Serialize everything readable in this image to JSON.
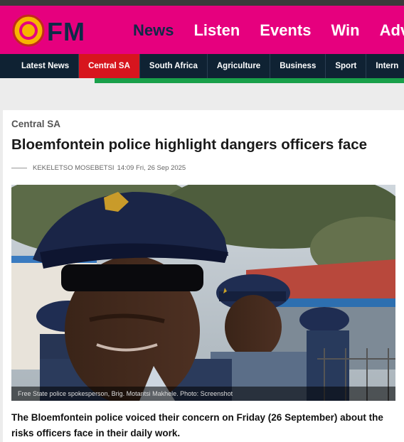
{
  "brand": {
    "logo_text": "OFM"
  },
  "main_nav": {
    "items": [
      {
        "label": "News",
        "active": true
      },
      {
        "label": "Listen",
        "active": false
      },
      {
        "label": "Events",
        "active": false
      },
      {
        "label": "Win",
        "active": false
      },
      {
        "label": "Adv",
        "active": false
      }
    ]
  },
  "sub_nav": {
    "items": [
      {
        "label": "Latest News",
        "active": false
      },
      {
        "label": "Central SA",
        "active": true
      },
      {
        "label": "South Africa",
        "active": false
      },
      {
        "label": "Agriculture",
        "active": false
      },
      {
        "label": "Business",
        "active": false
      },
      {
        "label": "Sport",
        "active": false
      },
      {
        "label": "Intern",
        "active": false
      }
    ]
  },
  "article": {
    "category": "Central SA",
    "title": "Bloemfontein police highlight dangers officers face",
    "author": "KEKELETSO MOSEBETSI",
    "date": "14:09 Fri, 26 Sep 2025",
    "photo_caption": "Free State police spokesperson, Brig. Motantsi Makhele. Photo: Screenshot",
    "lede": "The Bloemfontein police voiced their concern on Friday (26 September) about the risks officers face in their daily work."
  },
  "colors": {
    "brand_pink": "#e6007e",
    "nav_dark": "#0f2233",
    "active_red": "#d7151e",
    "accent_green": "#19a04a"
  }
}
